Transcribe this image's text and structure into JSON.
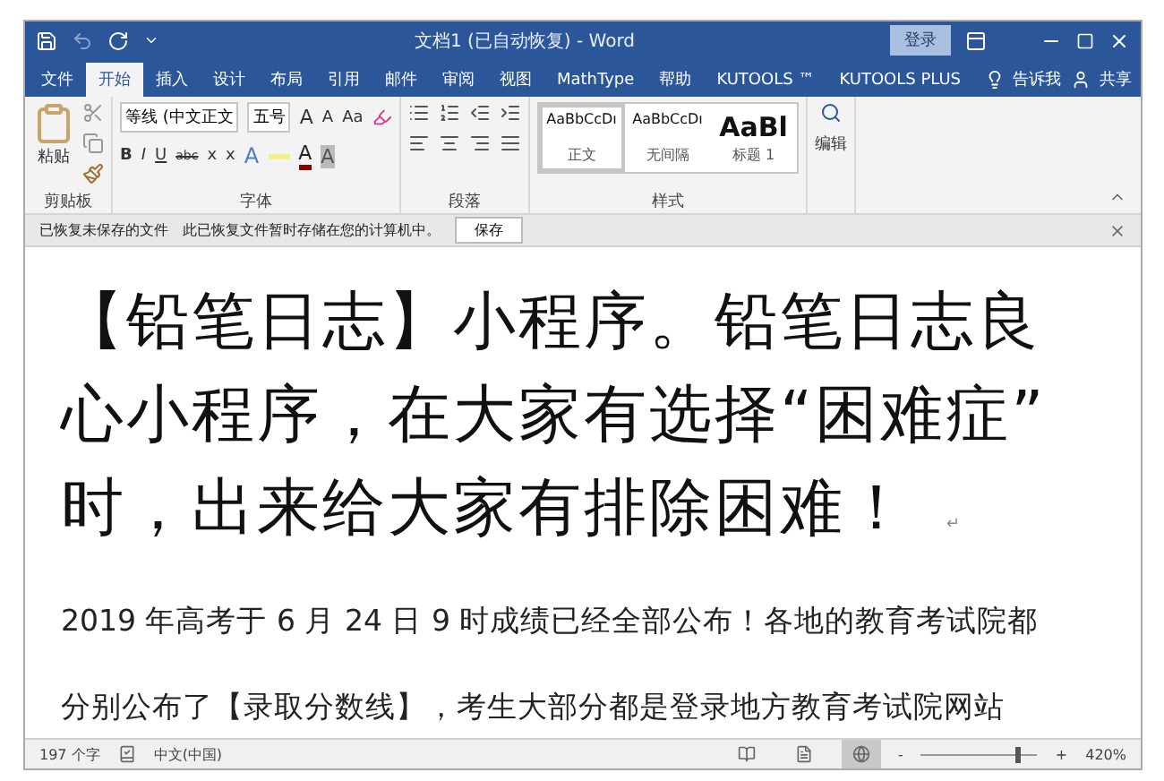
{
  "window": {
    "title": "文档1 (已自动恢复)  -  Word",
    "login": "登录"
  },
  "tabs": [
    {
      "label": "文件",
      "selected": false
    },
    {
      "label": "开始",
      "selected": true
    },
    {
      "label": "插入",
      "selected": false
    },
    {
      "label": "设计",
      "selected": false
    },
    {
      "label": "布局",
      "selected": false
    },
    {
      "label": "引用",
      "selected": false
    },
    {
      "label": "邮件",
      "selected": false
    },
    {
      "label": "审阅",
      "selected": false
    },
    {
      "label": "视图",
      "selected": false
    },
    {
      "label": "MathType",
      "selected": false
    },
    {
      "label": "帮助",
      "selected": false
    },
    {
      "label": "KUTOOLS ™",
      "selected": false
    },
    {
      "label": "KUTOOLS PLUS",
      "selected": false
    }
  ],
  "tell_me": "告诉我",
  "share": "共享",
  "ribbon": {
    "clipboard": {
      "paste": "粘贴",
      "label": "剪贴板"
    },
    "font": {
      "name": "等线 (中文正文",
      "size": "五号",
      "grow": "A",
      "shrink": "A",
      "case": "Aa",
      "bold": "B",
      "italic": "I",
      "underline": "U",
      "strike": "abc",
      "sub": "x",
      "sup": "x",
      "effects": "A",
      "font_color": "A",
      "shade": "A",
      "label": "字体"
    },
    "paragraph": {
      "label": "段落"
    },
    "styles": {
      "items": [
        {
          "preview": "AaBbCcDı",
          "name": "正文",
          "selected": true,
          "kind": "body"
        },
        {
          "preview": "AaBbCcDı",
          "name": "无间隔",
          "selected": false,
          "kind": "body"
        },
        {
          "preview": "AaBl",
          "name": "标题 1",
          "selected": false,
          "kind": "heading"
        }
      ],
      "label": "样式"
    },
    "editing": {
      "label": "编辑"
    }
  },
  "infobar": {
    "title": "已恢复未保存的文件",
    "message": "此已恢复文件暂时存储在您的计算机中。",
    "button": "保存"
  },
  "document": {
    "heading": [
      "【铅笔日志】小程序。铅笔日志良",
      "心小程序，在大家有选择“困难症”",
      "时，出来给大家有排除困难！"
    ],
    "paragraph_mark": "↵",
    "body": [
      "2019 年高考于 6 月 24 日 9 时成绩已经全部公布！各地的教育考试院都",
      "分别公布了【录取分数线】，考生大部分都是登录地方教育考试院网站"
    ]
  },
  "status": {
    "words": "197 个字",
    "language": "中文(中国)",
    "views": [
      {
        "selected": false
      },
      {
        "selected": false
      },
      {
        "selected": true
      }
    ],
    "zoom_minus": "-",
    "zoom_plus": "+",
    "zoom": {
      "level": 0.83
    },
    "zoom_label": "420%"
  }
}
